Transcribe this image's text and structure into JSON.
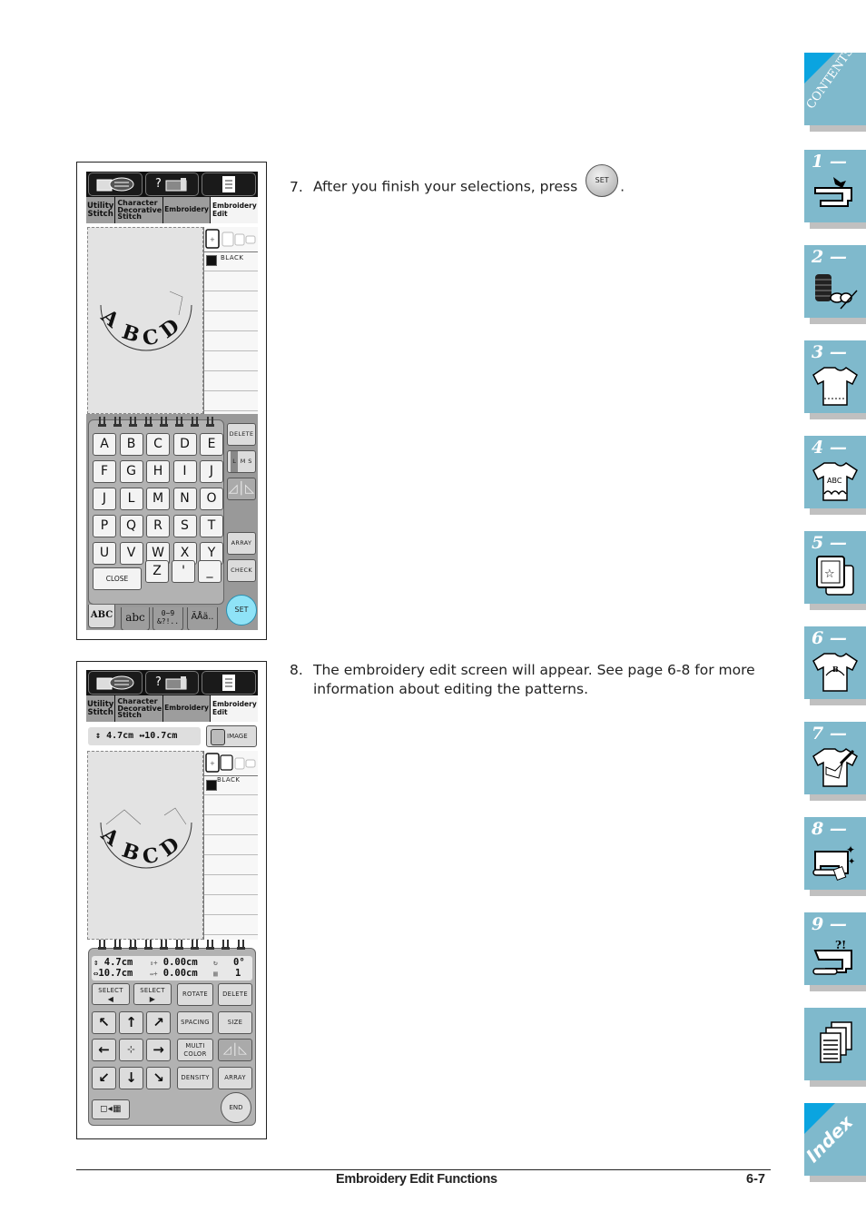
{
  "steps": [
    {
      "number": "7.",
      "text": "After you finish your selections, press",
      "inline_button": "SET",
      "after": "."
    },
    {
      "number": "8.",
      "line1": "The embroidery edit screen will appear. See page 6-8 for more",
      "line2": "information about editing the patterns."
    }
  ],
  "screen1": {
    "tabs": [
      {
        "label_l1": "Utility",
        "label_l2": "Stitch",
        "label_l3": ""
      },
      {
        "label_l1": "Character",
        "label_l2": "Decorative",
        "label_l3": "Stitch"
      },
      {
        "label_l1": "Embroidery",
        "label_l2": "",
        "label_l3": ""
      },
      {
        "label_l1": "Embroidery",
        "label_l2": "Edit",
        "label_l3": "",
        "active": true
      }
    ],
    "pattern_text": "ABCD",
    "thread_color": "BLACK",
    "keyboard_rows": [
      [
        "A",
        "B",
        "C",
        "D",
        "E"
      ],
      [
        "F",
        "G",
        "H",
        "I",
        "J"
      ],
      [
        "J",
        "L",
        "M",
        "N",
        "O"
      ],
      [
        "P",
        "Q",
        "R",
        "S",
        "T"
      ],
      [
        "U",
        "V",
        "W",
        "X",
        "Y"
      ]
    ],
    "last_row": {
      "close": "CLOSE",
      "keys": [
        "Z",
        "'",
        "_"
      ]
    },
    "side_buttons": {
      "delete": "DELETE",
      "size_l": "L",
      "size_m": "M",
      "size_s": "S",
      "array": "ARRAY",
      "check": "CHECK",
      "set": "SET"
    },
    "char_tabs": [
      {
        "label": "ABC",
        "active": true
      },
      {
        "label": "abc"
      },
      {
        "label_l1": "0~9",
        "label_l2": "&?!.."
      },
      {
        "label": "ÄÅä.."
      }
    ]
  },
  "screen2": {
    "tabs": [
      {
        "label_l1": "Utility",
        "label_l2": "Stitch",
        "label_l3": ""
      },
      {
        "label_l1": "Character",
        "label_l2": "Decorative",
        "label_l3": "Stitch"
      },
      {
        "label_l1": "Embroidery",
        "label_l2": "",
        "label_l3": ""
      },
      {
        "label_l1": "Embroidery",
        "label_l2": "Edit",
        "label_l3": "",
        "active": true
      }
    ],
    "size_height": "4.7cm",
    "size_width": "10.7cm",
    "image_button": "IMAGE",
    "thread_color": "BLACK",
    "pattern_text": "ABCD",
    "info": {
      "height": "4.7cm",
      "width": "10.7cm",
      "offset_vertical": "0.00cm",
      "offset_horizontal": "0.00cm",
      "rotation": "0°",
      "density_count": "1"
    },
    "buttons": {
      "select_prev": "SELECT",
      "select_next": "SELECT",
      "rotate": "ROTATE",
      "delete": "DELETE",
      "spacing": "SPACING",
      "size": "SIZE",
      "multi_color_l1": "MULTI",
      "multi_color_l2": "COLOR",
      "density": "DENSITY",
      "array": "ARRAY",
      "end": "END"
    }
  },
  "side_index": {
    "contents": "CONTENTS",
    "chapters": [
      "1 —",
      "2 —",
      "3 —",
      "4 —",
      "5 —",
      "6 —",
      "7 —",
      "8 —",
      "9 —"
    ],
    "index": "Index"
  },
  "footer": {
    "title": "Embroidery Edit Functions",
    "page": "6-7"
  }
}
